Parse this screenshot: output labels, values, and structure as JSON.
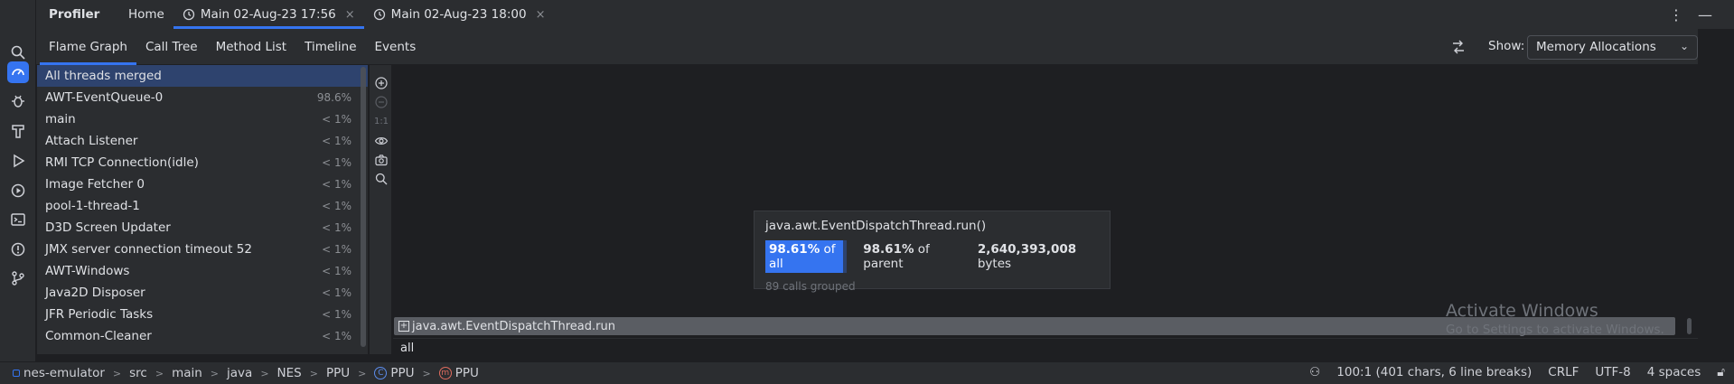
{
  "titlebar": {
    "title": "Profiler",
    "tabs": [
      {
        "label": "Home"
      },
      {
        "label": "Main 02-Aug-23 17:56",
        "active": true
      },
      {
        "label": "Main 02-Aug-23 18:00"
      }
    ],
    "close_glyph": "×"
  },
  "subtabs": {
    "tabs": [
      {
        "label": "Flame Graph",
        "active": true
      },
      {
        "label": "Call Tree"
      },
      {
        "label": "Method List"
      },
      {
        "label": "Timeline"
      },
      {
        "label": "Events"
      }
    ],
    "show_label": "Show:",
    "show_value": "Memory Allocations"
  },
  "threads": [
    {
      "name": "All threads merged",
      "pct": "",
      "selected": true
    },
    {
      "name": "AWT-EventQueue-0",
      "pct": "98.6%"
    },
    {
      "name": "main",
      "pct": "< 1%"
    },
    {
      "name": "Attach Listener",
      "pct": "< 1%"
    },
    {
      "name": "RMI TCP Connection(idle)",
      "pct": "< 1%"
    },
    {
      "name": "Image Fetcher 0",
      "pct": "< 1%"
    },
    {
      "name": "pool-1-thread-1",
      "pct": "< 1%"
    },
    {
      "name": "D3D Screen Updater",
      "pct": "< 1%"
    },
    {
      "name": "JMX server connection timeout 52",
      "pct": "< 1%"
    },
    {
      "name": "AWT-Windows",
      "pct": "< 1%"
    },
    {
      "name": "Java2D Disposer",
      "pct": "< 1%"
    },
    {
      "name": "JFR Periodic Tasks",
      "pct": "< 1%"
    },
    {
      "name": "Common-Cleaner",
      "pct": "< 1%"
    }
  ],
  "sidebar": {
    "ratio": "1:1"
  },
  "tooltip": {
    "title": "java.awt.EventDispatchThread.run()",
    "pct_all_value": "98.61%",
    "pct_all_label": "of all",
    "pct_parent_value": "98.61%",
    "pct_parent_label": "of parent",
    "bytes_value": "2,640,393,008",
    "bytes_label": "bytes",
    "note": "89 calls grouped"
  },
  "frame": {
    "label": "java.awt.EventDispatchThread.run"
  },
  "root": {
    "label": "all"
  },
  "watermark": {
    "line1": "Activate Windows",
    "line2": "Go to Settings to activate Windows."
  },
  "statusbar": {
    "crumbs": [
      "nes-emulator",
      "src",
      "main",
      "java",
      "NES",
      "PPU",
      "PPU",
      "PPU"
    ],
    "position": "100:1 (401 chars, 6 line breaks)",
    "line_sep": "CRLF",
    "encoding": "UTF-8",
    "indent": "4 spaces"
  },
  "colors": {
    "accent": "#3574f0",
    "selection": "#2e436e",
    "panel": "#2b2d30",
    "canvas": "#1e1f22"
  }
}
